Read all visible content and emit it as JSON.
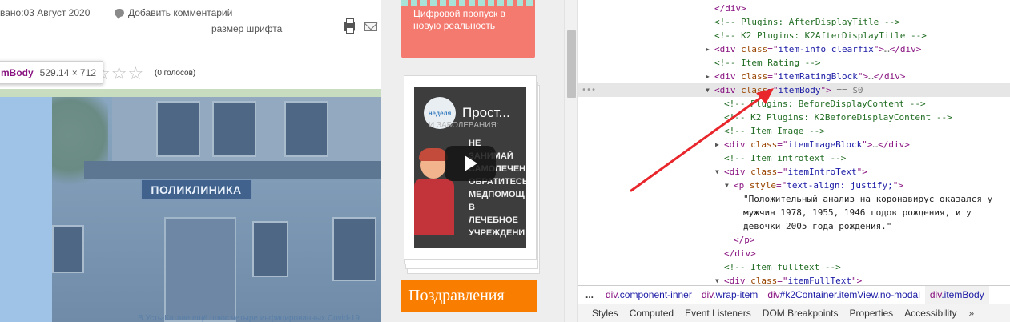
{
  "article": {
    "date_text": "вано:03 Август 2020",
    "comment_link": "Добавить комментарий",
    "font_size_label": "размер шрифта",
    "tooltip_name": "mBody",
    "tooltip_size": "529.14 × 712",
    "rating_votes": "(0 голосов)",
    "rating_stars": 0,
    "clinic_sign": "ПОЛИКЛИНИКА",
    "caption": "В Усть-Катаве ещё плюс четыре инфицированных Covid-19"
  },
  "sidebar": {
    "promo_text": "Цифровой пропуск в новую реальность",
    "video_logo": "неделя",
    "video_title": "Прост...",
    "video_subtitle": "И ЗАБОЛЕВАНИЯ:",
    "video_lines": [
      "НЕ ЗАНИМАЙ",
      "САМОЛЕЧЕН",
      "ОБРАТИТЕСЬ",
      "МЕДПОМОЩ",
      "В ЛЕЧЕБНОЕ",
      "УЧРЕЖДЕНИ"
    ],
    "congrats_label": "Поздравления"
  },
  "devtools": {
    "dom_lines": [
      {
        "indent": 0,
        "kind": "close",
        "tag": "div"
      },
      {
        "indent": 0,
        "kind": "comment",
        "text": "<!-- Plugins: AfterDisplayTitle -->"
      },
      {
        "indent": 0,
        "kind": "comment",
        "text": "<!-- K2 Plugins: K2AfterDisplayTitle -->"
      },
      {
        "indent": 0,
        "kind": "element",
        "arrow": "▶",
        "tag": "div",
        "attr": "class",
        "value": "item-info clearfix",
        "collapsed": true
      },
      {
        "indent": 0,
        "kind": "comment",
        "text": "<!-- Item Rating -->"
      },
      {
        "indent": 0,
        "kind": "element",
        "arrow": "▶",
        "tag": "div",
        "attr": "class",
        "value": "itemRatingBlock",
        "collapsed": true
      },
      {
        "indent": 0,
        "kind": "element",
        "arrow": "▼",
        "tag": "div",
        "attr": "class",
        "value": "itemBody",
        "selected": true,
        "suffix": " == $0"
      },
      {
        "indent": 1,
        "kind": "comment",
        "text": "<!-- Plugins: BeforeDisplayContent -->"
      },
      {
        "indent": 1,
        "kind": "comment",
        "text": "<!-- K2 Plugins: K2BeforeDisplayContent -->"
      },
      {
        "indent": 1,
        "kind": "comment",
        "text": "<!-- Item Image -->"
      },
      {
        "indent": 1,
        "kind": "element",
        "arrow": "▶",
        "tag": "div",
        "attr": "class",
        "value": "itemImageBlock",
        "collapsed": true
      },
      {
        "indent": 1,
        "kind": "comment",
        "text": "<!-- Item introtext -->"
      },
      {
        "indent": 1,
        "kind": "element",
        "arrow": "▼",
        "tag": "div",
        "attr": "class",
        "value": "itemIntroText"
      },
      {
        "indent": 2,
        "kind": "element",
        "arrow": "▼",
        "tag": "p",
        "attr": "style",
        "value": "text-align: justify;"
      },
      {
        "indent": 3,
        "kind": "text",
        "text": "\"Положительный анализ на коронавирус оказался у"
      },
      {
        "indent": 3,
        "kind": "text",
        "text": "мужчин 1978, 1955, 1946 годов рождения, и у"
      },
      {
        "indent": 3,
        "kind": "text",
        "text": "девочки 2005 года рождения.\""
      },
      {
        "indent": 2,
        "kind": "close",
        "tag": "p"
      },
      {
        "indent": 1,
        "kind": "close",
        "tag": "div"
      },
      {
        "indent": 1,
        "kind": "comment",
        "text": "<!-- Item fulltext -->"
      },
      {
        "indent": 1,
        "kind": "element",
        "arrow": "▼",
        "tag": "div",
        "attr": "class",
        "value": "itemFullText"
      }
    ],
    "breadcrumbs": [
      {
        "tag": "div",
        "rest": ".component-inner"
      },
      {
        "tag": "div",
        "rest": ".wrap-item"
      },
      {
        "tag": "div",
        "rest": "#k2Container.itemView.no-modal"
      },
      {
        "tag": "div",
        "rest": ".itemBody",
        "active": true
      }
    ],
    "breadcrumb_more": "...",
    "tabs": [
      "Styles",
      "Computed",
      "Event Listeners",
      "DOM Breakpoints",
      "Properties",
      "Accessibility"
    ],
    "tabs_more": "»"
  },
  "colors": {
    "annotation_arrow": "#e8262b",
    "promo_bg": "#f47a6f",
    "congrats_bg": "#f97e00",
    "devtools_tag": "#881280",
    "devtools_attr": "#994500",
    "devtools_value": "#1a1aa6",
    "devtools_comment": "#236e25"
  }
}
